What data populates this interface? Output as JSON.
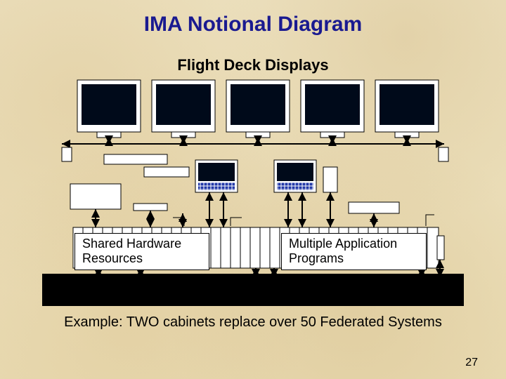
{
  "title": "IMA Notional Diagram",
  "subtitle": "Flight Deck Displays",
  "labels": {
    "left_box_line1": "Shared Hardware",
    "left_box_line2": "Resources",
    "right_box_line1": "Multiple Application",
    "right_box_line2": "Programs"
  },
  "example_text": "Example:  TWO cabinets replace over 50 Federated Systems",
  "page_number": "27",
  "diagram": {
    "num_displays": 5,
    "num_keyboards": 2,
    "description": "Five flight-deck CRT display boxes on a horizontal bus, two small keyboard/control boxes below center, striped module rack across bottom with two labeled overlay boxes, connected by double-headed arrows to a black bus band."
  }
}
